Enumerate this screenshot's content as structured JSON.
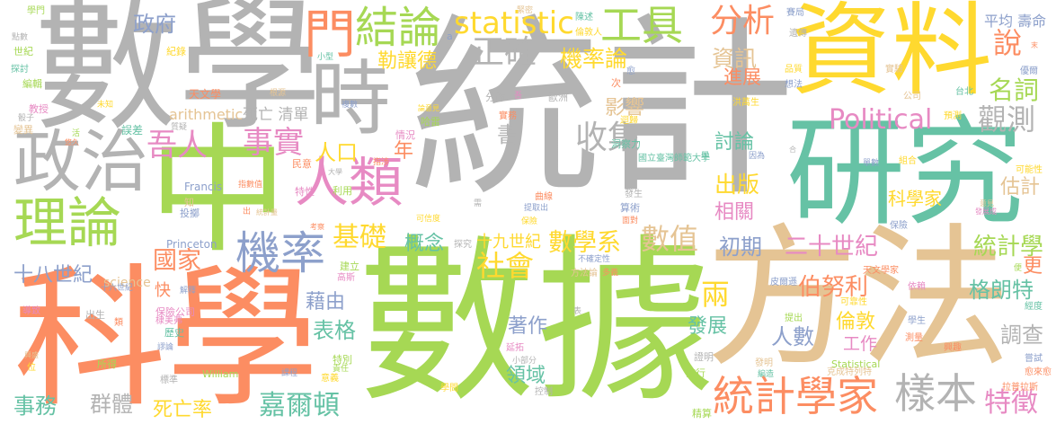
{
  "palette": {
    "gray": "#b3b3b3",
    "green": "#a6d854",
    "orange": "#fc8d62",
    "teal": "#66c2a5",
    "yellow": "#ffd92f",
    "tan": "#e5c494",
    "blue": "#8da0cb",
    "pink": "#e78ac3"
  },
  "words": [
    {
      "text": "數學",
      "color": "gray"
    },
    {
      "text": "時",
      "color": "gray"
    },
    {
      "text": "統計",
      "color": "gray"
    },
    {
      "text": "資料",
      "color": "yellow"
    },
    {
      "text": "研究",
      "color": "teal"
    },
    {
      "text": "中",
      "color": "green"
    },
    {
      "text": "科學",
      "color": "orange"
    },
    {
      "text": "數據",
      "color": "green"
    },
    {
      "text": "方法",
      "color": "tan"
    },
    {
      "text": "政治",
      "color": "gray"
    },
    {
      "text": "理論",
      "color": "green"
    },
    {
      "text": "人類",
      "color": "pink"
    },
    {
      "text": "機率",
      "color": "blue"
    },
    {
      "text": "門",
      "color": "orange"
    },
    {
      "text": "結論",
      "color": "green"
    },
    {
      "text": "statistic",
      "color": "yellow"
    },
    {
      "text": "工具",
      "color": "green"
    },
    {
      "text": "正確",
      "color": "gray"
    },
    {
      "text": "機率論",
      "color": "yellow"
    },
    {
      "text": "勒讓德",
      "color": "yellow"
    },
    {
      "text": "分析",
      "color": "orange"
    },
    {
      "text": "政府",
      "color": "blue"
    },
    {
      "text": "事實",
      "color": "pink"
    },
    {
      "text": "吾人",
      "color": "pink"
    },
    {
      "text": "人口",
      "color": "yellow"
    },
    {
      "text": "arithmetic",
      "color": "tan"
    },
    {
      "text": "死亡 清單",
      "color": "gray"
    },
    {
      "text": "影響",
      "color": "tan"
    },
    {
      "text": "收集",
      "color": "gray"
    },
    {
      "text": "書",
      "color": "gray"
    },
    {
      "text": "年",
      "color": "orange"
    },
    {
      "text": "資訊",
      "color": "tan"
    },
    {
      "text": "進展",
      "color": "orange"
    },
    {
      "text": "說",
      "color": "orange"
    },
    {
      "text": "平均 壽命",
      "color": "blue"
    },
    {
      "text": "名詞",
      "color": "green"
    },
    {
      "text": "Political",
      "color": "pink"
    },
    {
      "text": "觀測",
      "color": "gray"
    },
    {
      "text": "討論",
      "color": "teal"
    },
    {
      "text": "出版",
      "color": "yellow"
    },
    {
      "text": "相關",
      "color": "pink"
    },
    {
      "text": "科學家",
      "color": "yellow"
    },
    {
      "text": "估計",
      "color": "tan"
    },
    {
      "text": "初期",
      "color": "blue"
    },
    {
      "text": "二十世紀",
      "color": "pink"
    },
    {
      "text": "統計學",
      "color": "green"
    },
    {
      "text": "更",
      "color": "orange"
    },
    {
      "text": "伯努利",
      "color": "orange"
    },
    {
      "text": "格朗特",
      "color": "teal"
    },
    {
      "text": "倫敦",
      "color": "yellow"
    },
    {
      "text": "人數",
      "color": "blue"
    },
    {
      "text": "工作",
      "color": "pink"
    },
    {
      "text": "調查",
      "color": "gray"
    },
    {
      "text": "統計學家",
      "color": "orange"
    },
    {
      "text": "樣本",
      "color": "gray"
    },
    {
      "text": "特徵",
      "color": "pink"
    },
    {
      "text": "兩",
      "color": "yellow"
    },
    {
      "text": "發展",
      "color": "teal"
    },
    {
      "text": "數值",
      "color": "tan"
    },
    {
      "text": "數學系",
      "color": "yellow"
    },
    {
      "text": "十九世紀",
      "color": "yellow"
    },
    {
      "text": "概念",
      "color": "teal"
    },
    {
      "text": "社會",
      "color": "yellow"
    },
    {
      "text": "基礎",
      "color": "yellow"
    },
    {
      "text": "國家",
      "color": "orange"
    },
    {
      "text": "十八世紀",
      "color": "blue"
    },
    {
      "text": "science",
      "color": "tan"
    },
    {
      "text": "快",
      "color": "orange"
    },
    {
      "text": "藉由",
      "color": "blue"
    },
    {
      "text": "表格",
      "color": "teal"
    },
    {
      "text": "嘉爾頓",
      "color": "teal"
    },
    {
      "text": "死亡率",
      "color": "yellow"
    },
    {
      "text": "群體",
      "color": "gray"
    },
    {
      "text": "事務",
      "color": "teal"
    },
    {
      "text": "著作",
      "color": "blue"
    },
    {
      "text": "領域",
      "color": "teal"
    },
    {
      "text": "學門",
      "color": "green"
    },
    {
      "text": "點數",
      "color": "gray"
    },
    {
      "text": "世紀",
      "color": "green"
    },
    {
      "text": "探討",
      "color": "teal"
    },
    {
      "text": "編輯",
      "color": "green"
    },
    {
      "text": "教授",
      "color": "pink"
    },
    {
      "text": "骰子",
      "color": "gray"
    },
    {
      "text": "變異",
      "color": "tan"
    },
    {
      "text": "紀錄",
      "color": "yellow"
    },
    {
      "text": "小型",
      "color": "teal"
    },
    {
      "text": "天文學",
      "color": "orange"
    },
    {
      "text": "根源",
      "color": "tan"
    },
    {
      "text": "未知",
      "color": "yellow"
    },
    {
      "text": "複數",
      "color": "blue"
    },
    {
      "text": "誤差",
      "color": "teal"
    },
    {
      "text": "活",
      "color": "green"
    },
    {
      "text": "質疑",
      "color": "gray"
    },
    {
      "text": "悠久",
      "color": "orange"
    },
    {
      "text": "民意",
      "color": "orange"
    },
    {
      "text": "大學",
      "color": "gray"
    },
    {
      "text": "Francis",
      "color": "blue"
    },
    {
      "text": "指數值",
      "color": "orange"
    },
    {
      "text": "特性",
      "color": "pink"
    },
    {
      "text": "利用",
      "color": "green"
    },
    {
      "text": "知",
      "color": "tan"
    },
    {
      "text": "投擲",
      "color": "blue"
    },
    {
      "text": "出",
      "color": "orange"
    },
    {
      "text": "統計量",
      "color": "tan"
    },
    {
      "text": "考察",
      "color": "orange"
    },
    {
      "text": "Princeton",
      "color": "blue"
    },
    {
      "text": "建立",
      "color": "green"
    },
    {
      "text": "高斯",
      "color": "pink"
    },
    {
      "text": "十六世紀",
      "color": "blue"
    },
    {
      "text": "解釋",
      "color": "blue"
    },
    {
      "text": "導致",
      "color": "pink"
    },
    {
      "text": "保險公司",
      "color": "pink"
    },
    {
      "text": "出生",
      "color": "gray"
    },
    {
      "text": "棣美弗",
      "color": "pink"
    },
    {
      "text": "類",
      "color": "orange"
    },
    {
      "text": "歷史",
      "color": "teal"
    },
    {
      "text": "謬論",
      "color": "blue"
    },
    {
      "text": "興盛",
      "color": "tan"
    },
    {
      "text": "所得",
      "color": "green"
    },
    {
      "text": "特別",
      "color": "green"
    },
    {
      "text": "位",
      "color": "yellow"
    },
    {
      "text": "責任",
      "color": "green"
    },
    {
      "text": "William",
      "color": "green"
    },
    {
      "text": "標準",
      "color": "gray"
    },
    {
      "text": "課程",
      "color": "blue"
    },
    {
      "text": "意義",
      "color": "yellow"
    },
    {
      "text": "緊密",
      "color": "tan"
    },
    {
      "text": "陳述",
      "color": "teal"
    },
    {
      "text": "倫敦人",
      "color": "yellow"
    },
    {
      "text": "a",
      "color": "blue"
    },
    {
      "text": "愈",
      "color": "blue"
    },
    {
      "text": "次",
      "color": "orange"
    },
    {
      "text": "分佈",
      "color": "gray"
    },
    {
      "text": "吾",
      "color": "pink"
    },
    {
      "text": "歐洲",
      "color": "gray"
    },
    {
      "text": "論意見",
      "color": "yellow"
    },
    {
      "text": "實務",
      "color": "orange"
    },
    {
      "text": "哈雷",
      "color": "green"
    },
    {
      "text": "迴歸",
      "color": "yellow"
    },
    {
      "text": "情況",
      "color": "pink"
    },
    {
      "text": "洞察力",
      "color": "teal"
    },
    {
      "text": "指涉",
      "color": "orange"
    },
    {
      "text": "國立臺灣師範大學",
      "color": "teal"
    },
    {
      "text": "曲線",
      "color": "orange"
    },
    {
      "text": "發生",
      "color": "gray"
    },
    {
      "text": "需",
      "color": "gray"
    },
    {
      "text": "提取出",
      "color": "blue"
    },
    {
      "text": "算術",
      "color": "blue"
    },
    {
      "text": "可信度",
      "color": "yellow"
    },
    {
      "text": "保險",
      "color": "yellow"
    },
    {
      "text": "面對",
      "color": "orange"
    },
    {
      "text": "探究",
      "color": "gray"
    },
    {
      "text": "不確定性",
      "color": "blue"
    },
    {
      "text": "方法論",
      "color": "tan"
    },
    {
      "text": "多義",
      "color": "orange"
    },
    {
      "text": "表",
      "color": "gray"
    },
    {
      "text": "延拓",
      "color": "pink"
    },
    {
      "text": "小部分",
      "color": "gray"
    },
    {
      "text": "證明",
      "color": "gray"
    },
    {
      "text": "流行",
      "color": "green"
    },
    {
      "text": "學問",
      "color": "yellow"
    },
    {
      "text": "控制",
      "color": "gray"
    },
    {
      "text": "精算",
      "color": "green"
    },
    {
      "text": "賽局",
      "color": "blue"
    },
    {
      "text": "遺傳",
      "color": "gray"
    },
    {
      "text": "品質",
      "color": "yellow"
    },
    {
      "text": "實驗",
      "color": "tan"
    },
    {
      "text": "優爾",
      "color": "blue"
    },
    {
      "text": "想法",
      "color": "blue"
    },
    {
      "text": "台北",
      "color": "teal"
    },
    {
      "text": "公司",
      "color": "tan"
    },
    {
      "text": "洪萬生",
      "color": "yellow"
    },
    {
      "text": "末",
      "color": "orange"
    },
    {
      "text": "預測",
      "color": "yellow"
    },
    {
      "text": "合",
      "color": "gray"
    },
    {
      "text": "學",
      "color": "teal"
    },
    {
      "text": "因為",
      "color": "blue"
    },
    {
      "text": "組合",
      "color": "yellow"
    },
    {
      "text": "單數",
      "color": "blue"
    },
    {
      "text": "意見",
      "color": "tan"
    },
    {
      "text": "發展成",
      "color": "pink"
    },
    {
      "text": "可能性",
      "color": "yellow"
    },
    {
      "text": "保險",
      "color": "blue"
    },
    {
      "text": "天文學家",
      "color": "orange"
    },
    {
      "text": "便",
      "color": "green"
    },
    {
      "text": "皮爾遜",
      "color": "blue"
    },
    {
      "text": "依賴",
      "color": "pink"
    },
    {
      "text": "可靠性",
      "color": "yellow"
    },
    {
      "text": "經度",
      "color": "teal"
    },
    {
      "text": "提出",
      "color": "green"
    },
    {
      "text": "學生",
      "color": "blue"
    },
    {
      "text": "測量",
      "color": "orange"
    },
    {
      "text": "興趣",
      "color": "orange"
    },
    {
      "text": "嘗試",
      "color": "blue"
    },
    {
      "text": "發明",
      "color": "tan"
    },
    {
      "text": "Statistical",
      "color": "green"
    },
    {
      "text": "編造",
      "color": "teal"
    },
    {
      "text": "克成特列特",
      "color": "tan"
    },
    {
      "text": "愈來愈",
      "color": "orange"
    },
    {
      "text": "拉普拉斯",
      "color": "orange"
    }
  ]
}
